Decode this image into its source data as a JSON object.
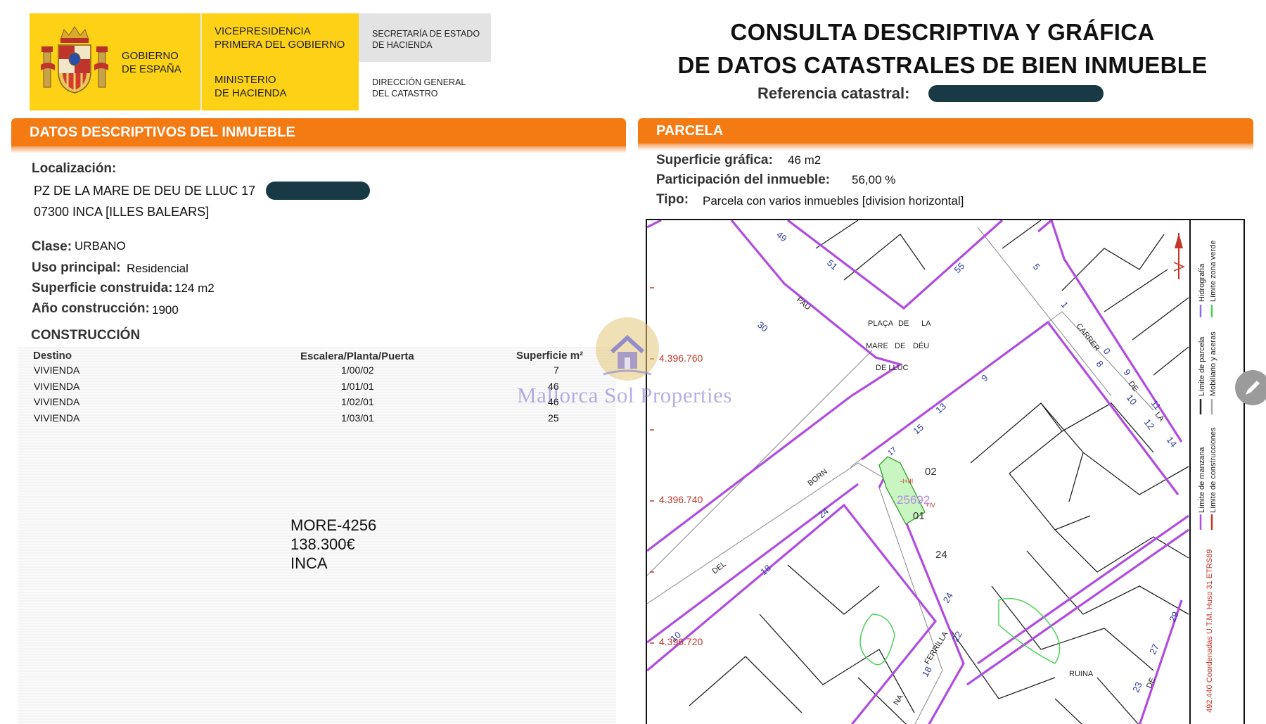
{
  "header": {
    "gobierno": [
      "GOBIERNO",
      "DE ESPAÑA"
    ],
    "vicepresidencia": [
      "VICEPRESIDENCIA",
      "PRIMERA DEL GOBIERNO"
    ],
    "ministerio": [
      "MINISTERIO",
      "DE HACIENDA"
    ],
    "secretaria": [
      "SECRETARÍA DE ESTADO",
      "DE HACIENDA"
    ],
    "direccion": [
      "DIRECCIÓN GENERAL",
      "DEL CATASTRO"
    ]
  },
  "title": [
    "CONSULTA DESCRIPTIVA Y GRÁFICA",
    "DE DATOS CATASTRALES DE BIEN INMUEBLE"
  ],
  "referencia_label": "Referencia catastral:",
  "datos": {
    "section_title": "DATOS DESCRIPTIVOS DEL INMUEBLE",
    "localizacion_label": "Localización:",
    "address_line1": "PZ DE LA MARE DE DEU DE LLUC 17",
    "address_line2": "07300 INCA [ILLES BALEARS]",
    "clase_label": "Clase:",
    "clase": "URBANO",
    "uso_label": "Uso principal:",
    "uso": "Residencial",
    "superficie_label": "Superficie construida:",
    "superficie": "124 m2",
    "anio_label": "Año construcción:",
    "anio": "1900"
  },
  "construccion": {
    "title": "CONSTRUCCIÓN",
    "headers": [
      "Destino",
      "Escalera/Planta/Puerta",
      "Superficie m²"
    ],
    "rows": [
      [
        "VIVIENDA",
        "1/00/02",
        "7"
      ],
      [
        "VIVIENDA",
        "1/01/01",
        "46"
      ],
      [
        "VIVIENDA",
        "1/02/01",
        "46"
      ],
      [
        "VIVIENDA",
        "1/03/01",
        "25"
      ]
    ]
  },
  "listing": {
    "ref": "MORE-4256",
    "price": "138.300€",
    "town": "INCA"
  },
  "watermark": "Mallorca Sol Properties",
  "parcela": {
    "section_title": "PARCELA",
    "superficie_label": "Superficie gráfica:",
    "superficie": "46 m2",
    "participacion_label": "Participación del inmueble:",
    "participacion": "56,00 %",
    "tipo_label": "Tipo:",
    "tipo": "Parcela con varios inmuebles [division horizontal]"
  },
  "map": {
    "coords_y": [
      "4.396.760",
      "4.396.740",
      "4.396.720"
    ],
    "street_labels": [
      "PLAÇA",
      "DE",
      "LA",
      "MARE",
      "DE",
      "DÉU",
      "DE LLUC",
      "PAU",
      "CARRER",
      "DE",
      "LA",
      "BORN",
      "DEL",
      "FERRILLA",
      "NA",
      "DE",
      "RUINA"
    ],
    "numbers": [
      "49",
      "51",
      "55",
      "5",
      "1",
      "30",
      "0",
      "8",
      "9",
      "9",
      "10",
      "11",
      "12",
      "13",
      "14",
      "15",
      "17",
      "24",
      "18",
      "10",
      "24",
      "22",
      "18",
      "29",
      "27",
      "23"
    ],
    "parcel_label": "25692",
    "unit_labels": [
      "02",
      "01",
      "24"
    ],
    "floor_labels": [
      "-I+III",
      "+IV"
    ],
    "legend": [
      "Límite de manzana",
      "Límite de parcela",
      "Hidrografía",
      "Límite de construcciones",
      "Mobiliario y aceras",
      "Límite zona verde"
    ],
    "utm_note": "492.440 Coordenadas U.T.M. Huso 31 ETRS89",
    "colors": {
      "block": "#b04ce0",
      "coord": "#c0392b",
      "number": "#2b3a9b",
      "green": "#4bd35a",
      "parcel_fill": "#c9f5c0"
    }
  }
}
